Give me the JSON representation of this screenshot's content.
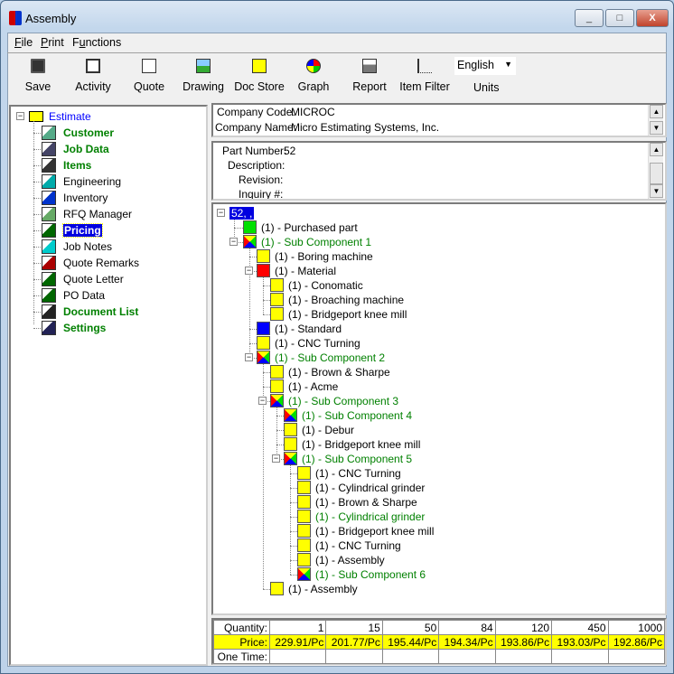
{
  "window": {
    "title": "Assembly",
    "controls": [
      "_",
      "□",
      "X"
    ]
  },
  "menu": [
    {
      "label": "File",
      "u": "F",
      "rest": "ile"
    },
    {
      "label": "Print",
      "u": "P",
      "rest": "rint"
    },
    {
      "label": "Functions",
      "pre": "F",
      "u": "u",
      "rest": "nctions"
    }
  ],
  "toolbar": [
    {
      "label": "Save",
      "icon": "floppy-disk-icon"
    },
    {
      "label": "Activity",
      "icon": "calendar-icon"
    },
    {
      "label": "Quote",
      "icon": "quote-dollar-icon"
    },
    {
      "label": "Drawing",
      "icon": "picture-icon"
    },
    {
      "label": "Doc Store",
      "icon": "folder-icon"
    },
    {
      "label": "Graph",
      "icon": "pie-chart-icon"
    },
    {
      "label": "Report",
      "icon": "printer-icon"
    },
    {
      "label": "Item Filter",
      "icon": "tree-filter-icon"
    }
  ],
  "units": {
    "value": "English",
    "label": "Units"
  },
  "nav": {
    "root": "Estimate",
    "items": [
      {
        "label": "Customer",
        "bold": true
      },
      {
        "label": "Job Data",
        "bold": true
      },
      {
        "label": "Items",
        "bold": true
      },
      {
        "label": "Engineering"
      },
      {
        "label": "Inventory"
      },
      {
        "label": "RFQ Manager"
      },
      {
        "label": "Pricing",
        "bold": true,
        "selected": true
      },
      {
        "label": "Job Notes"
      },
      {
        "label": "Quote Remarks"
      },
      {
        "label": "Quote Letter"
      },
      {
        "label": "PO Data"
      },
      {
        "label": "Document List",
        "bold": true
      },
      {
        "label": "Settings",
        "bold": true
      }
    ]
  },
  "company": {
    "code_label": "Company Code:",
    "code": "MICROC",
    "name_label": "Company Name:",
    "name": "Micro Estimating Systems, Inc."
  },
  "part": {
    "number_label": "Part Number:",
    "number": "52",
    "description_label": "Description:",
    "revision_label": "Revision:",
    "inquiry_label": "Inquiry #:"
  },
  "colors": {
    "yellow": "#ffff00",
    "green": "#00e000",
    "red": "#ff0000",
    "blue": "#0000ff",
    "selection": "#0000e0",
    "text_green": "#008000"
  },
  "tree": [
    {
      "level": 0,
      "label": "52, ,",
      "selected": true,
      "expanded": true
    },
    {
      "level": 1,
      "icon": "green",
      "label": "(1) - Purchased part"
    },
    {
      "level": 1,
      "icon": "multi",
      "label": "(1) - Sub Component 1",
      "green": true,
      "expanded": true
    },
    {
      "level": 2,
      "icon": "yellow",
      "label": "(1) - Boring machine"
    },
    {
      "level": 2,
      "icon": "red",
      "label": "(1) - Material",
      "expanded": true
    },
    {
      "level": 3,
      "icon": "yellow",
      "label": "(1) - Conomatic"
    },
    {
      "level": 3,
      "icon": "yellow",
      "label": "(1) - Broaching machine"
    },
    {
      "level": 3,
      "icon": "yellow",
      "label": "(1) - Bridgeport knee mill"
    },
    {
      "level": 2,
      "icon": "blue",
      "label": "(1) - Standard"
    },
    {
      "level": 2,
      "icon": "yellow",
      "label": "(1) - CNC Turning"
    },
    {
      "level": 2,
      "icon": "multi",
      "label": "(1) - Sub Component 2",
      "green": true,
      "expanded": true
    },
    {
      "level": 3,
      "icon": "yellow",
      "label": "(1) - Brown & Sharpe"
    },
    {
      "level": 3,
      "icon": "yellow",
      "label": "(1) - Acme"
    },
    {
      "level": 3,
      "icon": "multi",
      "label": "(1) - Sub Component 3",
      "green": true,
      "expanded": true
    },
    {
      "level": 4,
      "icon": "multi",
      "label": "(1) - Sub Component 4",
      "green": true
    },
    {
      "level": 4,
      "icon": "yellow",
      "label": "(1) - Debur"
    },
    {
      "level": 4,
      "icon": "yellow",
      "label": "(1) - Bridgeport knee mill"
    },
    {
      "level": 4,
      "icon": "multi",
      "label": "(1) - Sub Component 5",
      "green": true,
      "expanded": true
    },
    {
      "level": 5,
      "icon": "yellow",
      "label": "(1) - CNC Turning"
    },
    {
      "level": 5,
      "icon": "yellow",
      "label": "(1) - Cylindrical grinder"
    },
    {
      "level": 5,
      "icon": "yellow",
      "label": "(1) - Brown & Sharpe"
    },
    {
      "level": 5,
      "icon": "yellow",
      "label": "(1) - Cylindrical grinder",
      "green": true
    },
    {
      "level": 5,
      "icon": "yellow",
      "label": "(1) - Bridgeport knee mill"
    },
    {
      "level": 5,
      "icon": "yellow",
      "label": "(1) - CNC Turning"
    },
    {
      "level": 5,
      "icon": "yellow",
      "label": "(1) - Assembly"
    },
    {
      "level": 5,
      "icon": "multi",
      "label": "(1) - Sub Component 6",
      "green": true
    },
    {
      "level": 3,
      "icon": "yellow",
      "label": "(1) - Assembly"
    }
  ],
  "pricing": {
    "quantity_label": "Quantity:",
    "price_label": "Price:",
    "onetime_label": "One Time:",
    "quantities": [
      "1",
      "15",
      "50",
      "84",
      "120",
      "450",
      "1000"
    ],
    "prices": [
      "229.91/Pc",
      "201.77/Pc",
      "195.44/Pc",
      "194.34/Pc",
      "193.86/Pc",
      "193.03/Pc",
      "192.86/Pc"
    ]
  }
}
